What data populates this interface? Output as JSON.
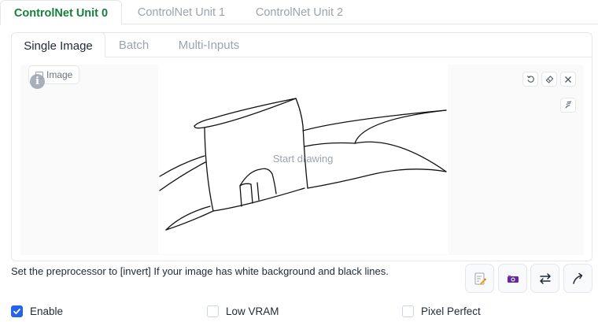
{
  "unit_tabs": [
    "ControlNet Unit 0",
    "ControlNet Unit 1",
    "ControlNet Unit 2"
  ],
  "active_unit_tab": 0,
  "mode_tabs": [
    "Single Image",
    "Batch",
    "Multi-Inputs"
  ],
  "active_mode_tab": 0,
  "image_block": {
    "label": "Image",
    "info_glyph": "i",
    "placeholder": "Start drawing",
    "icons": [
      "image-icon",
      "undo-icon",
      "eraser-icon",
      "close-icon",
      "brush-icon"
    ]
  },
  "hint_text": "Set the preprocessor to [invert] If your image has white background and black lines.",
  "tool_buttons": [
    "edit-icon",
    "camera-icon",
    "swap-icon",
    "send-icon"
  ],
  "checkboxes": {
    "enable": {
      "label": "Enable",
      "checked": true
    },
    "low_vram": {
      "label": "Low VRAM",
      "checked": false
    },
    "pixel_perfect": {
      "label": "Pixel Perfect",
      "checked": false
    }
  },
  "colors": {
    "accent_green": "#15803d",
    "checkbox_blue": "#2563eb",
    "muted_text": "#9ca3af",
    "border": "#e5e7eb"
  }
}
